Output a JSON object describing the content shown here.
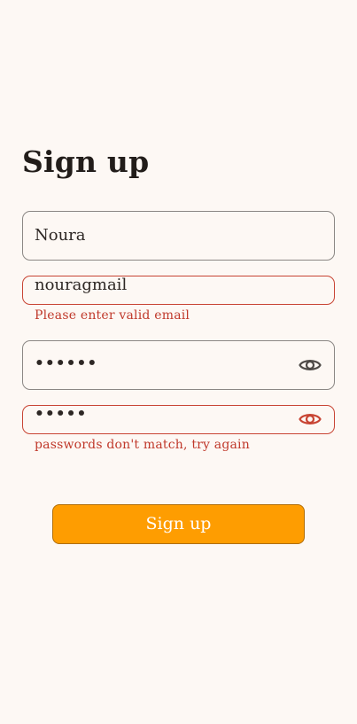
{
  "page": {
    "title": "Sign up"
  },
  "form": {
    "name": {
      "value": "Noura"
    },
    "email": {
      "value": "nouragmail",
      "error": "Please enter valid email"
    },
    "password": {
      "value": "••••••",
      "icon": "eye-icon"
    },
    "confirm_password": {
      "value": "•••••",
      "icon": "eye-icon",
      "error": "passwords don't match, try again"
    },
    "submit_label": "Sign up"
  },
  "colors": {
    "background": "#fdf8f4",
    "error": "#c84433",
    "button": "#fe9d01",
    "text": "#221d1a"
  }
}
